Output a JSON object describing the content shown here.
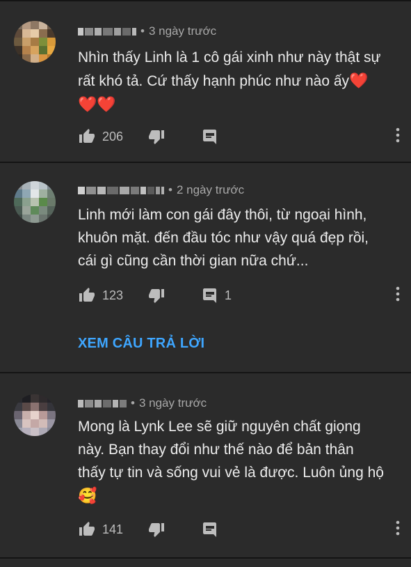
{
  "comments": [
    {
      "time": "3 ngày trước",
      "text": "Nhìn thấy Linh là 1 cô gái xinh như này thật sự\nrất khó tả. Cứ thấy hạnh phúc như nào ấy",
      "emoji": "❤️",
      "emoji_tail": "❤️❤️",
      "likes": "206",
      "replies": ""
    },
    {
      "time": "2 ngày trước",
      "text": "Linh mới làm con gái đây thôi, từ ngoại hình,\nkhuôn mặt. đến đầu tóc như vậy quá đẹp rồi,\ncái gì cũng cần thời gian nữa chứ...",
      "likes": "123",
      "replies": "1",
      "view_replies": "XEM CÂU TRẢ LỜI"
    },
    {
      "time": "3 ngày trước",
      "text": "Mong là Lynk Lee sẽ giữ nguyên chất giọng\nnày. Bạn thay đổi như thế nào để bản thân\nthấy tự tin và sống vui vẻ là được. Luôn ủng hộ",
      "emoji": "🥰",
      "likes": "141",
      "replies": ""
    }
  ],
  "separator": "•",
  "icons": {
    "like": "thumb-up-icon",
    "dislike": "thumb-down-icon",
    "reply": "comment-icon",
    "more": "more-vert-icon"
  },
  "colors": {
    "background": "#2b2b2b",
    "link": "#3ea6ff",
    "secondary_text": "#a8a8a8"
  }
}
